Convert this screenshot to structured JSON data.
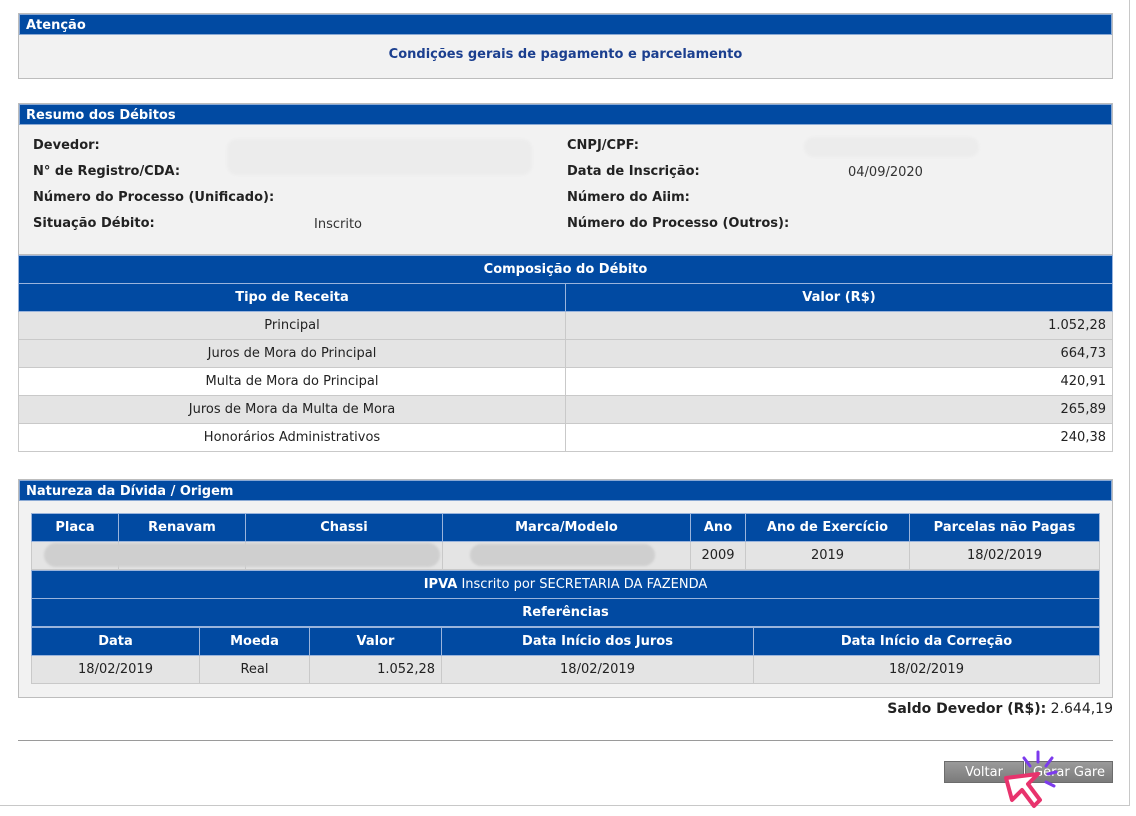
{
  "attention": {
    "title": "Atenção",
    "link_text": "Condições gerais de pagamento e parcelamento"
  },
  "resumo": {
    "title": "Resumo dos Débitos",
    "devedor_label": "Devedor:",
    "registro_label": "N° de Registro/CDA:",
    "processo_unificado_label": "Número do Processo (Unificado):",
    "situacao_label": "Situação Débito:",
    "situacao_value": "Inscrito",
    "cnpj_label": "CNPJ/CPF:",
    "data_inscricao_label": "Data de Inscrição:",
    "data_inscricao_value": "04/09/2020",
    "aiim_label": "Número do Aiim:",
    "processo_outros_label": "Número do Processo (Outros):"
  },
  "composicao": {
    "title": "Composição do Débito",
    "col_tipo": "Tipo de Receita",
    "col_valor": "Valor (R$)",
    "rows": [
      {
        "tipo": "Principal",
        "valor": "1.052,28"
      },
      {
        "tipo": "Juros de Mora do Principal",
        "valor": "664,73"
      },
      {
        "tipo": "Multa de Mora do Principal",
        "valor": "420,91"
      },
      {
        "tipo": "Juros de Mora da Multa de Mora",
        "valor": "265,89"
      },
      {
        "tipo": "Honorários Administrativos",
        "valor": "240,38"
      }
    ]
  },
  "natureza": {
    "title": "Natureza da Dívida / Origem",
    "cols": {
      "placa": "Placa",
      "renavam": "Renavam",
      "chassi": "Chassi",
      "marca": "Marca/Modelo",
      "ano": "Ano",
      "exercicio": "Ano de Exercício",
      "parcelas": "Parcelas não Pagas"
    },
    "row": {
      "ano": "2009",
      "exercicio": "2019",
      "parcelas": "18/02/2019"
    },
    "ipva_bold": "IPVA",
    "ipva_text": "Inscrito por SECRETARIA DA FAZENDA",
    "referencias": "Referências",
    "ref_cols": {
      "data": "Data",
      "moeda": "Moeda",
      "valor": "Valor",
      "juros": "Data Início dos Juros",
      "correcao": "Data Início da Correção"
    },
    "ref_row": {
      "data": "18/02/2019",
      "moeda": "Real",
      "valor": "1.052,28",
      "juros": "18/02/2019",
      "correcao": "18/02/2019"
    }
  },
  "saldo": {
    "label": "Saldo Devedor (R$):",
    "value": "2.644,19"
  },
  "buttons": {
    "voltar": "Voltar",
    "gerar": "Gerar Gare"
  },
  "colors": {
    "header_blue": "#014aa2",
    "panel_gray": "#f2f2f2",
    "cursor_pink": "#e8336d",
    "cursor_purple": "#7c3aed"
  }
}
